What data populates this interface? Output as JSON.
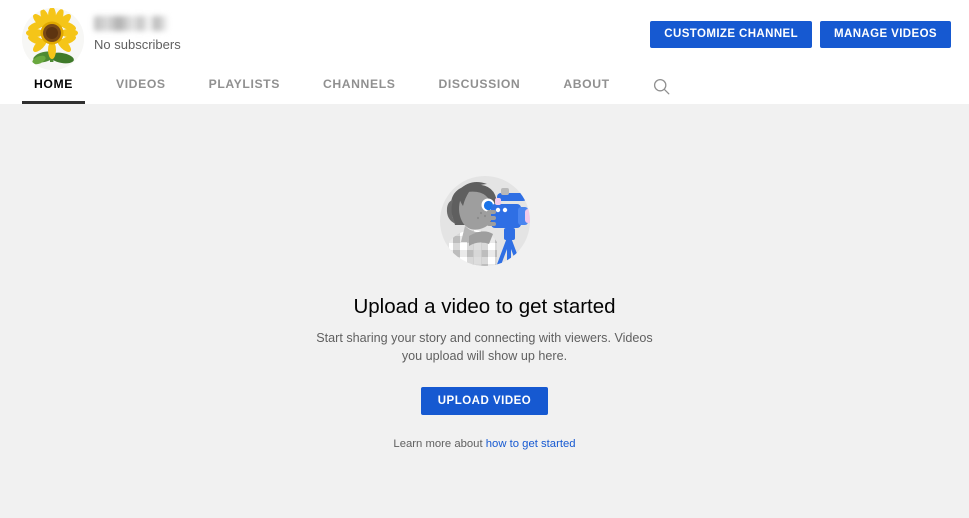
{
  "channel": {
    "name_redacted": true,
    "subscriber_count": "No subscribers",
    "avatar_icon": "sunflower-avatar"
  },
  "header": {
    "actions": [
      {
        "label": "CUSTOMIZE CHANNEL",
        "name": "customize-channel-button"
      },
      {
        "label": "MANAGE VIDEOS",
        "name": "manage-videos-button"
      }
    ],
    "tabs": [
      {
        "label": "HOME",
        "active": true
      },
      {
        "label": "VIDEOS",
        "active": false
      },
      {
        "label": "PLAYLISTS",
        "active": false
      },
      {
        "label": "CHANNELS",
        "active": false
      },
      {
        "label": "DISCUSSION",
        "active": false
      },
      {
        "label": "ABOUT",
        "active": false
      }
    ],
    "search_icon": "search-icon"
  },
  "empty_state": {
    "illustration": "person-with-video-camera-illustration",
    "title": "Upload a video to get started",
    "subtitle": "Start sharing your story and connecting with viewers. Videos you upload will show up here.",
    "upload_button": "UPLOAD VIDEO",
    "learn_more_prefix": "Learn more about",
    "learn_more_link": "how to get started"
  },
  "colors": {
    "accent_blue": "#1659d1",
    "link_blue": "#1659d1",
    "page_background": "#f1f1f1",
    "header_background": "#ffffff",
    "active_tab_underline": "#303030",
    "secondary_text": "#606060"
  }
}
